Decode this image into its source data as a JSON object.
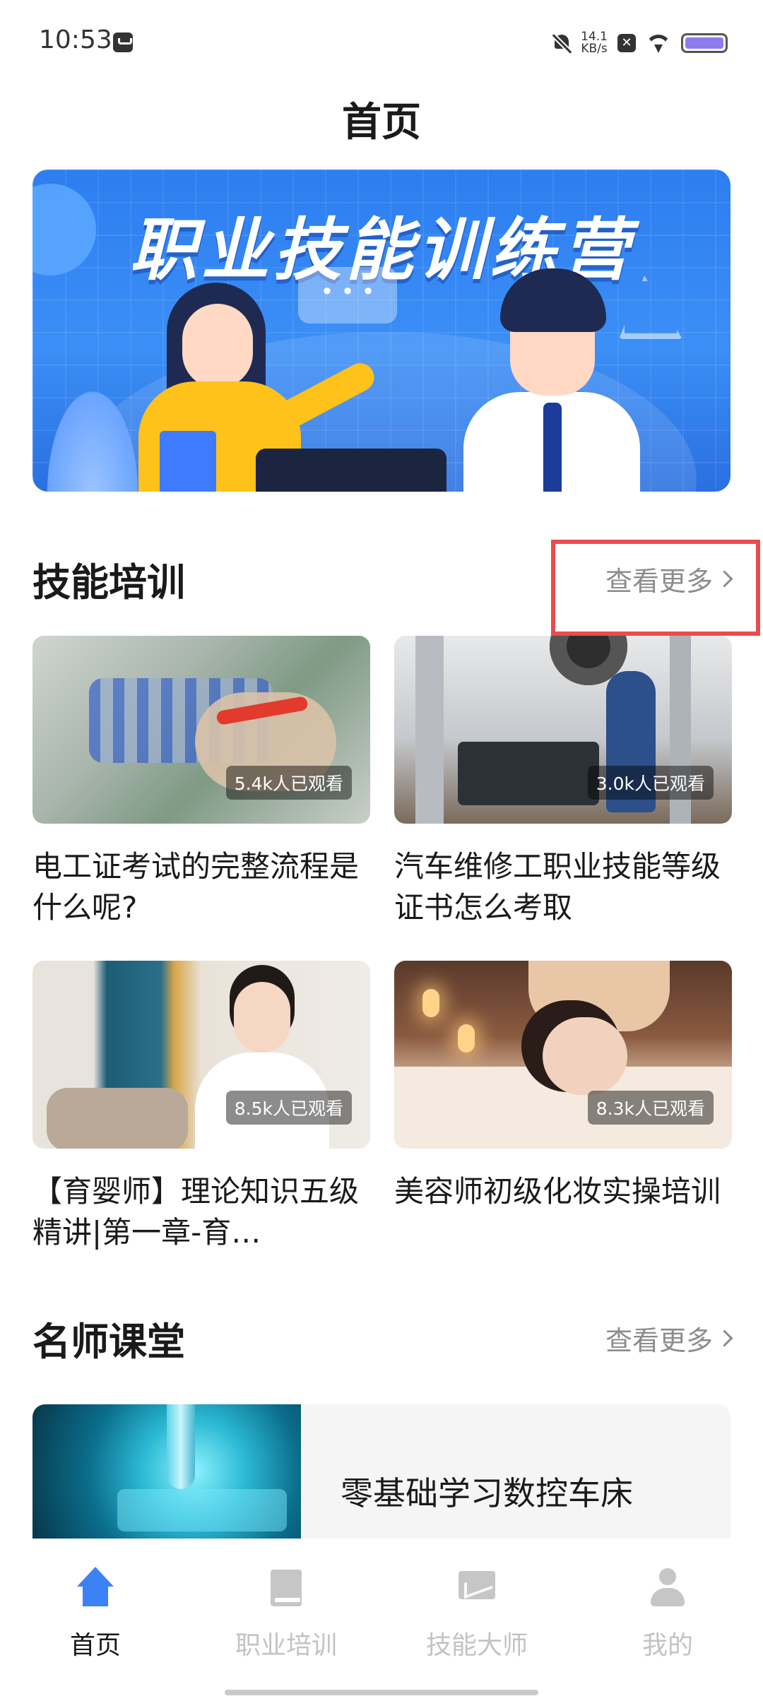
{
  "status_bar": {
    "time": "10:53",
    "net_speed_value": "14.1",
    "net_speed_unit": "KB/s"
  },
  "header": {
    "title": "首页"
  },
  "banner": {
    "title": "职业技能训练营"
  },
  "skill_training": {
    "title": "技能培训",
    "see_more": "查看更多",
    "cards": [
      {
        "views": "5.4k人已观看",
        "title": "电工证考试的完整流程是什么呢?"
      },
      {
        "views": "3.0k人已观看",
        "title": "汽车维修工职业技能等级证书怎么考取"
      },
      {
        "views": "8.5k人已观看",
        "title": "【育婴师】理论知识五级精讲|第一章-育…"
      },
      {
        "views": "8.3k人已观看",
        "title": "美容师初级化妆实操培训"
      }
    ]
  },
  "teacher_class": {
    "title": "名师课堂",
    "see_more": "查看更多",
    "course_title": "零基础学习数控车床"
  },
  "bottom_nav": {
    "items": [
      {
        "label": "首页",
        "icon": "home-icon",
        "active": true
      },
      {
        "label": "职业培训",
        "icon": "book-icon",
        "active": false
      },
      {
        "label": "技能大师",
        "icon": "chart-icon",
        "active": false
      },
      {
        "label": "我的",
        "icon": "user-icon",
        "active": false
      }
    ]
  },
  "colors": {
    "accent": "#3b82f6",
    "highlight_box": "#ea4c4c",
    "inactive_nav": "#c3c3c3"
  }
}
